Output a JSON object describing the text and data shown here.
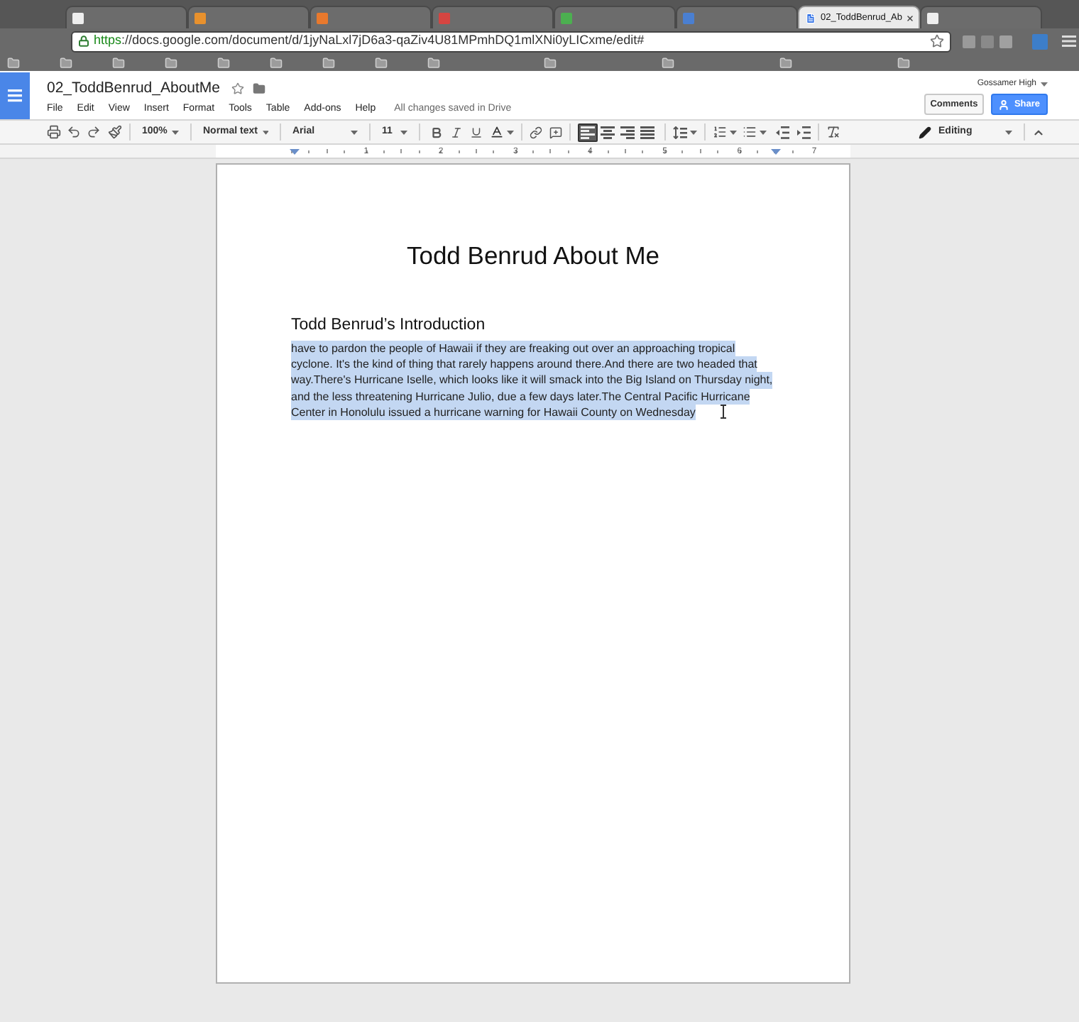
{
  "browser": {
    "tabs": [
      {
        "selected": false
      },
      {
        "selected": false
      },
      {
        "selected": false
      },
      {
        "selected": false
      },
      {
        "selected": false
      },
      {
        "selected": false
      },
      {
        "title": "02_ToddBenrud_Ab",
        "selected": true
      },
      {
        "selected": false
      }
    ],
    "url": {
      "scheme": "https",
      "rest": "://docs.google.com/document/d/1jyNaLxl7jD6a3-qaZiv4U81MPmhDQ1mlXNi0yLICxme/edit#"
    }
  },
  "docs": {
    "title": "02_ToddBenrud_AboutMe",
    "starred": false,
    "menu": [
      "File",
      "Edit",
      "View",
      "Insert",
      "Format",
      "Tools",
      "Table",
      "Add-ons",
      "Help"
    ],
    "save_status": "All changes saved in Drive",
    "account": "Gossamer High",
    "comments_button": "Comments",
    "share_button": "Share"
  },
  "toolbar": {
    "zoom": "100%",
    "style": "Normal text",
    "font": "Arial",
    "size": "11",
    "alignment": [
      {
        "selected": true
      },
      {
        "selected": false
      },
      {
        "selected": false
      },
      {
        "selected": false
      }
    ],
    "mode": "Editing"
  },
  "ruler": {
    "labels": [
      "1",
      "2",
      "3",
      "4",
      "5",
      "6",
      "7"
    ]
  },
  "document": {
    "title": "Todd Benrud About Me",
    "heading": "Todd Benrud’s Introduction",
    "paragraph": {
      "selected": true,
      "lines": [
        "have to pardon the people of Hawaii if they are freaking out over an approaching tropical",
        "cyclone. It's the kind of thing that rarely happens around there.And there are two headed that",
        "way.There's Hurricane Iselle, which looks like it will smack into the Big Island on Thursday night,",
        "and the less threatening Hurricane Julio, due a few days later.The Central Pacific Hurricane",
        "Center in Honolulu issued a hurricane warning for Hawaii County on Wednesday"
      ]
    }
  }
}
